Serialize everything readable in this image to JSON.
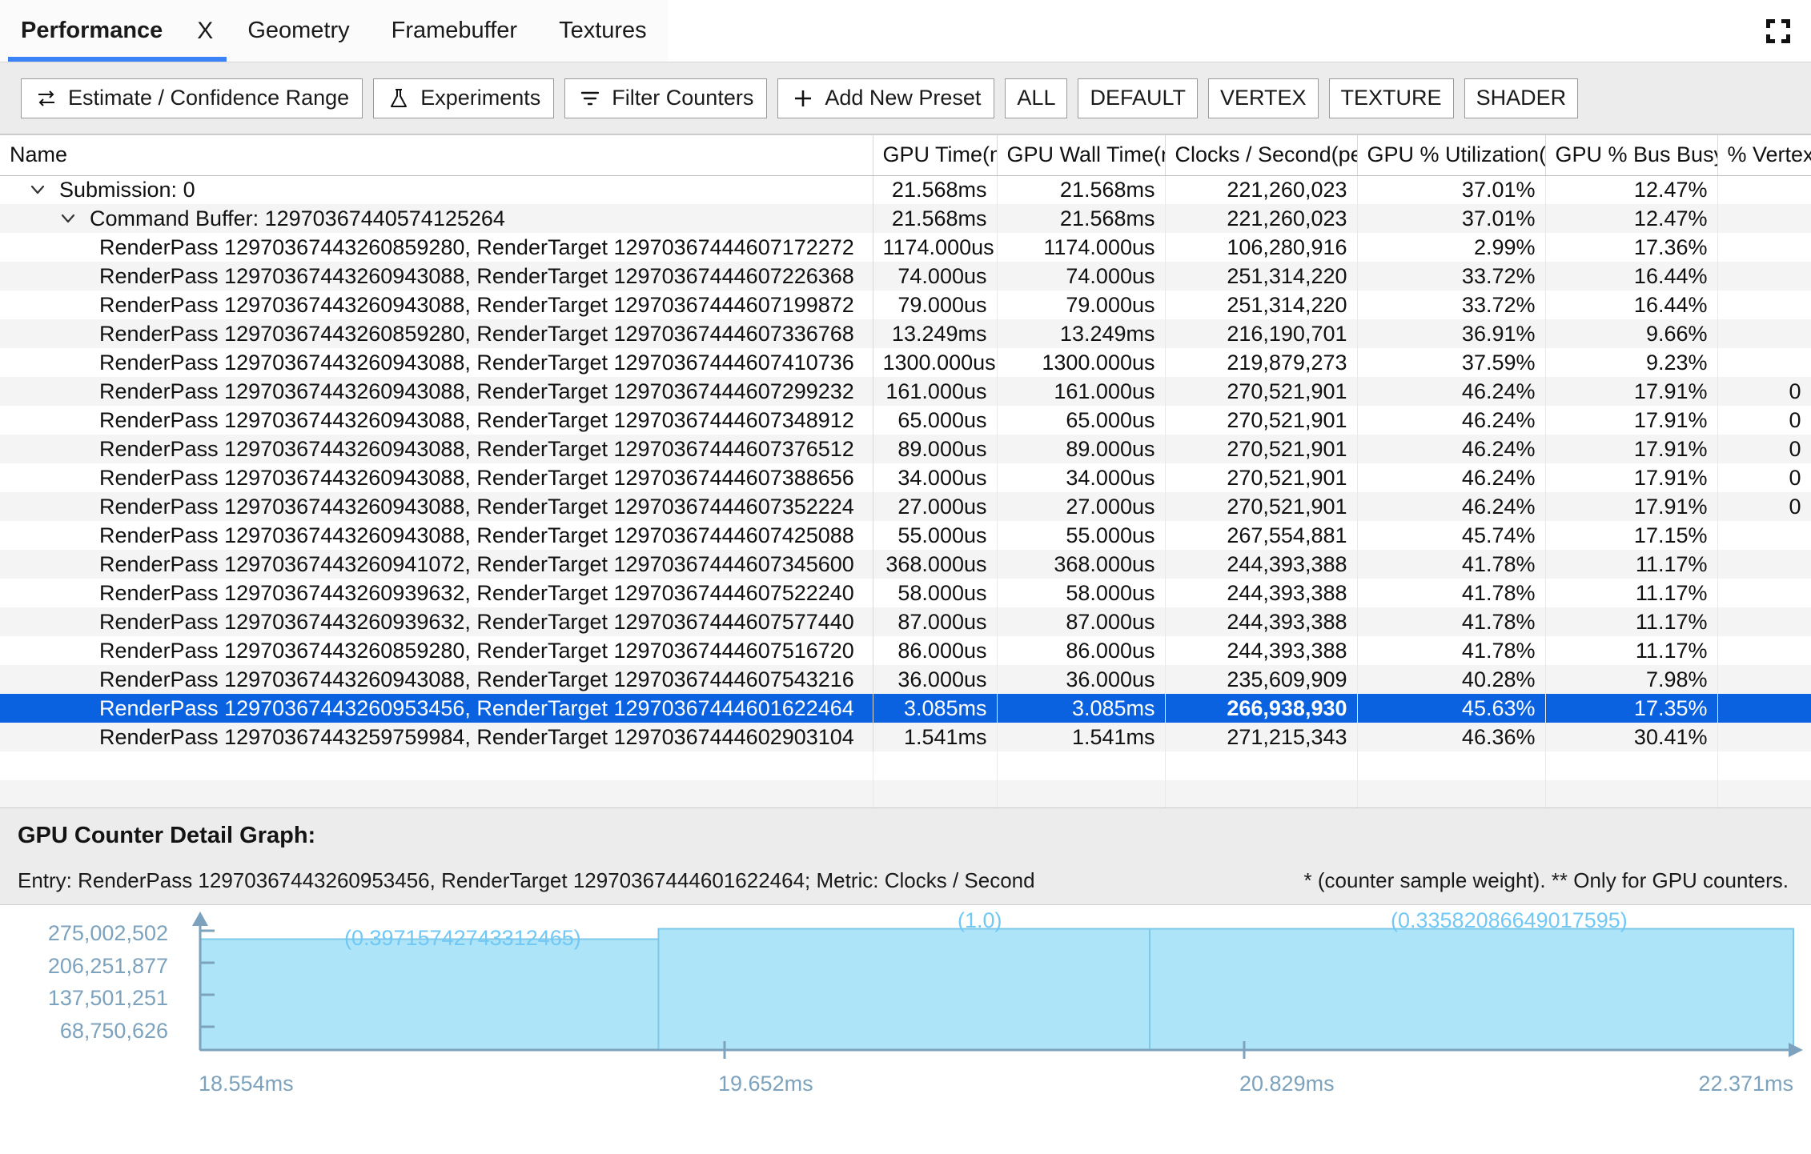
{
  "tabs": [
    {
      "label": "Performance",
      "active": true,
      "closable": true
    },
    {
      "label": "Geometry",
      "active": false
    },
    {
      "label": "Framebuffer",
      "active": false
    },
    {
      "label": "Textures",
      "active": false
    }
  ],
  "close_glyph": "X",
  "window": {
    "fullscreen_icon": "fullscreen-expand-icon"
  },
  "toolbar": {
    "buttons": [
      {
        "label": "Estimate / Confidence Range",
        "icon": "swap-arrows-icon"
      },
      {
        "label": "Experiments",
        "icon": "flask-icon"
      },
      {
        "label": "Filter Counters",
        "icon": "filter-icon"
      },
      {
        "label": "Add New Preset",
        "icon": "plus-icon"
      }
    ],
    "presets": [
      "ALL",
      "DEFAULT",
      "VERTEX",
      "TEXTURE",
      "SHADER"
    ]
  },
  "table": {
    "columns": [
      "Name",
      "GPU Time(ns)",
      "GPU Wall Time(ns)",
      "Clocks / Second(per s)",
      "GPU % Utilization(%)",
      "GPU % Bus Busy(%)",
      "% Vertex"
    ],
    "rows": [
      {
        "name": "Submission: 0",
        "level": 1,
        "expander": "chevron-down",
        "gpu_time": "21.568ms",
        "gpu_wall": "21.568ms",
        "clocks": "221,260,023",
        "util": "37.01%",
        "bus": "12.47%",
        "vertex": "",
        "selected": false
      },
      {
        "name": "Command Buffer: 12970367440574125264",
        "level": 2,
        "expander": "chevron-down",
        "gpu_time": "21.568ms",
        "gpu_wall": "21.568ms",
        "clocks": "221,260,023",
        "util": "37.01%",
        "bus": "12.47%",
        "vertex": "",
        "selected": false
      },
      {
        "name": "RenderPass 12970367443260859280, RenderTarget 12970367444607172272",
        "level": 3,
        "gpu_time": "1174.000us",
        "gpu_wall": "1174.000us",
        "clocks": "106,280,916",
        "util": "2.99%",
        "bus": "17.36%",
        "vertex": "",
        "selected": false
      },
      {
        "name": "RenderPass 12970367443260943088, RenderTarget 12970367444607226368",
        "level": 3,
        "gpu_time": "74.000us",
        "gpu_wall": "74.000us",
        "clocks": "251,314,220",
        "util": "33.72%",
        "bus": "16.44%",
        "vertex": "",
        "selected": false
      },
      {
        "name": "RenderPass 12970367443260943088, RenderTarget 12970367444607199872",
        "level": 3,
        "gpu_time": "79.000us",
        "gpu_wall": "79.000us",
        "clocks": "251,314,220",
        "util": "33.72%",
        "bus": "16.44%",
        "vertex": "",
        "selected": false
      },
      {
        "name": "RenderPass 12970367443260859280, RenderTarget 12970367444607336768",
        "level": 3,
        "gpu_time": "13.249ms",
        "gpu_wall": "13.249ms",
        "clocks": "216,190,701",
        "util": "36.91%",
        "bus": "9.66%",
        "vertex": "",
        "selected": false
      },
      {
        "name": "RenderPass 12970367443260943088, RenderTarget 12970367444607410736",
        "level": 3,
        "gpu_time": "1300.000us",
        "gpu_wall": "1300.000us",
        "clocks": "219,879,273",
        "util": "37.59%",
        "bus": "9.23%",
        "vertex": "",
        "selected": false
      },
      {
        "name": "RenderPass 12970367443260943088, RenderTarget 12970367444607299232",
        "level": 3,
        "gpu_time": "161.000us",
        "gpu_wall": "161.000us",
        "clocks": "270,521,901",
        "util": "46.24%",
        "bus": "17.91%",
        "vertex": "0",
        "selected": false
      },
      {
        "name": "RenderPass 12970367443260943088, RenderTarget 12970367444607348912",
        "level": 3,
        "gpu_time": "65.000us",
        "gpu_wall": "65.000us",
        "clocks": "270,521,901",
        "util": "46.24%",
        "bus": "17.91%",
        "vertex": "0",
        "selected": false
      },
      {
        "name": "RenderPass 12970367443260943088, RenderTarget 12970367444607376512",
        "level": 3,
        "gpu_time": "89.000us",
        "gpu_wall": "89.000us",
        "clocks": "270,521,901",
        "util": "46.24%",
        "bus": "17.91%",
        "vertex": "0",
        "selected": false
      },
      {
        "name": "RenderPass 12970367443260943088, RenderTarget 12970367444607388656",
        "level": 3,
        "gpu_time": "34.000us",
        "gpu_wall": "34.000us",
        "clocks": "270,521,901",
        "util": "46.24%",
        "bus": "17.91%",
        "vertex": "0",
        "selected": false
      },
      {
        "name": "RenderPass 12970367443260943088, RenderTarget 12970367444607352224",
        "level": 3,
        "gpu_time": "27.000us",
        "gpu_wall": "27.000us",
        "clocks": "270,521,901",
        "util": "46.24%",
        "bus": "17.91%",
        "vertex": "0",
        "selected": false
      },
      {
        "name": "RenderPass 12970367443260943088, RenderTarget 12970367444607425088",
        "level": 3,
        "gpu_time": "55.000us",
        "gpu_wall": "55.000us",
        "clocks": "267,554,881",
        "util": "45.74%",
        "bus": "17.15%",
        "vertex": "",
        "selected": false
      },
      {
        "name": "RenderPass 12970367443260941072, RenderTarget 12970367444607345600",
        "level": 3,
        "gpu_time": "368.000us",
        "gpu_wall": "368.000us",
        "clocks": "244,393,388",
        "util": "41.78%",
        "bus": "11.17%",
        "vertex": "",
        "selected": false
      },
      {
        "name": "RenderPass 12970367443260939632, RenderTarget 12970367444607522240",
        "level": 3,
        "gpu_time": "58.000us",
        "gpu_wall": "58.000us",
        "clocks": "244,393,388",
        "util": "41.78%",
        "bus": "11.17%",
        "vertex": "",
        "selected": false
      },
      {
        "name": "RenderPass 12970367443260939632, RenderTarget 12970367444607577440",
        "level": 3,
        "gpu_time": "87.000us",
        "gpu_wall": "87.000us",
        "clocks": "244,393,388",
        "util": "41.78%",
        "bus": "11.17%",
        "vertex": "",
        "selected": false
      },
      {
        "name": "RenderPass 12970367443260859280, RenderTarget 12970367444607516720",
        "level": 3,
        "gpu_time": "86.000us",
        "gpu_wall": "86.000us",
        "clocks": "244,393,388",
        "util": "41.78%",
        "bus": "11.17%",
        "vertex": "",
        "selected": false
      },
      {
        "name": "RenderPass 12970367443260943088, RenderTarget 12970367444607543216",
        "level": 3,
        "gpu_time": "36.000us",
        "gpu_wall": "36.000us",
        "clocks": "235,609,909",
        "util": "40.28%",
        "bus": "7.98%",
        "vertex": "",
        "selected": false
      },
      {
        "name": "RenderPass 12970367443260953456, RenderTarget 12970367444601622464",
        "level": 3,
        "gpu_time": "3.085ms",
        "gpu_wall": "3.085ms",
        "clocks": "266,938,930",
        "util": "45.63%",
        "bus": "17.35%",
        "vertex": "",
        "selected": true
      },
      {
        "name": "RenderPass 12970367443259759984, RenderTarget 12970367444602903104",
        "level": 3,
        "gpu_time": "1.541ms",
        "gpu_wall": "1.541ms",
        "clocks": "271,215,343",
        "util": "46.36%",
        "bus": "30.41%",
        "vertex": "",
        "selected": false
      }
    ],
    "blank_row_count": 2
  },
  "detail": {
    "title": "GPU Counter Detail Graph:",
    "entry": "Entry: RenderPass 12970367443260953456, RenderTarget 12970367444601622464; Metric: Clocks / Second",
    "note": "* (counter sample weight). ** Only for GPU counters."
  },
  "chart_data": {
    "type": "area",
    "title": "",
    "xlabel": "",
    "ylabel": "",
    "grid": false,
    "legend": null,
    "y_ticks": [
      "275,002,502",
      "206,251,877",
      "137,501,251",
      "68,750,626"
    ],
    "y_tick_values": [
      275002502,
      206251877,
      137501251,
      68750626
    ],
    "x_ticks": [
      "18.554ms",
      "19.652ms",
      "20.829ms",
      "22.371ms"
    ],
    "x_tick_values": [
      18.554,
      19.652,
      20.829,
      22.371
    ],
    "annotations": [
      "(0.39715742743312465)",
      "(1.0)",
      "(0.33582086649017595)"
    ],
    "segments": [
      {
        "x_start": 18.554,
        "x_end": 19.652,
        "weight": 0.39715742743312465,
        "level": 0.86
      },
      {
        "x_start": 19.652,
        "x_end": 20.829,
        "weight": 1.0,
        "level": 0.94
      },
      {
        "x_start": 20.829,
        "x_end": 22.371,
        "weight": 0.33582086649017595,
        "level": 0.94
      }
    ],
    "colors": {
      "fill": "#ade4f8",
      "stroke": "#7ec9ea",
      "axis": "#7da2bd",
      "annotation": "#72c8f5"
    }
  }
}
